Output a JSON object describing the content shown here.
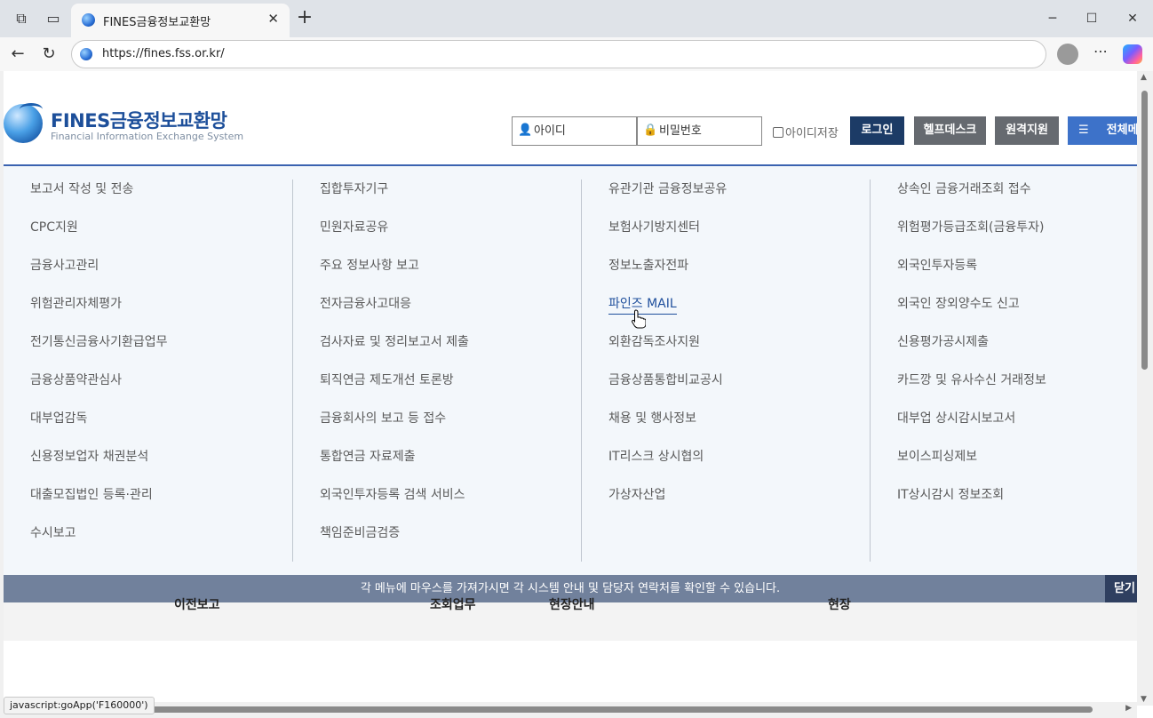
{
  "browser": {
    "tab_title": "FINES금융정보교환망",
    "url": "https://fines.fss.or.kr/",
    "status_link": "javascript:goApp('F160000')"
  },
  "header": {
    "logo_title": "FINES금융정보교환망",
    "logo_subtitle": "Financial Information Exchange System",
    "id_placeholder": "아이디",
    "pw_placeholder": "비밀번호",
    "save_id_label": "아이디저장",
    "login_label": "로그인",
    "helpdesk_label": "헬프데스크",
    "remote_label": "원격지원",
    "allmenu_label": "전체메"
  },
  "menu": {
    "columns": [
      {
        "items": [
          "보고서 작성 및 전송",
          "CPC지원",
          "금융사고관리",
          "위험관리자체평가",
          "전기통신금융사기환급업무",
          "금융상품약관심사",
          "대부업감독",
          "신용정보업자 채권분석",
          "대출모집법인 등록·관리",
          "수시보고"
        ]
      },
      {
        "items": [
          "집합투자기구",
          "민원자료공유",
          "주요 정보사항 보고",
          "전자금융사고대응",
          "검사자료 및 정리보고서 제출",
          "퇴직연금 제도개선 토론방",
          "금융회사의 보고 등 접수",
          "통합연금 자료제출",
          "외국인투자등록 검색 서비스",
          "책임준비금검증"
        ]
      },
      {
        "items": [
          "유관기관 금융정보공유",
          "보험사기방지센터",
          "정보노출자전파",
          "파인즈 MAIL",
          "외환감독조사지원",
          "금융상품통합비교공시",
          "채용 및 행사정보",
          "IT리스크 상시협의",
          "가상자산업"
        ]
      },
      {
        "items": [
          "상속인 금융거래조회 접수",
          "위험평가등급조회(금융투자)",
          "외국인투자등록",
          "외국인 장외양수도 신고",
          "신용평가공시제출",
          "카드깡 및 유사수신 거래정보",
          "대부업 상시감시보고서",
          "보이스피싱제보",
          "IT상시감시 정보조회"
        ]
      }
    ],
    "hovered": "파인즈 MAIL"
  },
  "notice": {
    "text": "각 메뉴에 마우스를 가져가시면 각 시스템 안내 및 담당자 연락처를 확인할 수 있습니다.",
    "close_label": "닫기"
  },
  "behind": {
    "labels": [
      "이전보고",
      "조회업무",
      "현장안내",
      "현장"
    ]
  }
}
